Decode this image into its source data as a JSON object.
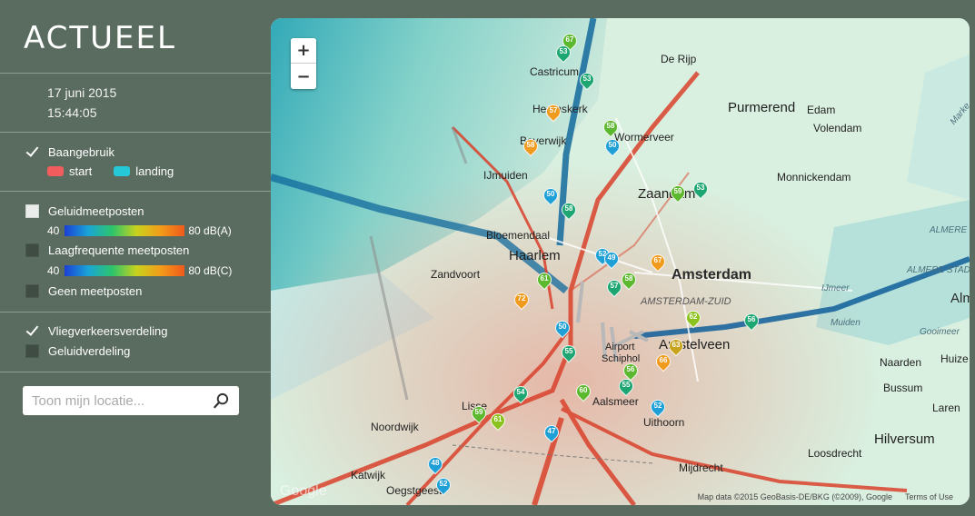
{
  "sidebar": {
    "title": "ACTUEEL",
    "date": "17 juni 2015",
    "time": "15:44:05",
    "runway_use": {
      "label": "Baangebruik",
      "checked": true,
      "legend": [
        {
          "label": "start",
          "color": "#f25c5c"
        },
        {
          "label": "landing",
          "color": "#24c8d6"
        }
      ]
    },
    "noise_posts": {
      "label": "Geluidmeetposten",
      "scale_min": "40",
      "scale_max": "80 dB(A)"
    },
    "low_freq_posts": {
      "label": "Laagfrequente meetposten",
      "scale_min": "40",
      "scale_max": "80 dB(C)"
    },
    "no_posts": {
      "label": "Geen meetposten"
    },
    "flight_distribution": {
      "label": "Vliegverkeersverdeling",
      "checked": true
    },
    "noise_distribution": {
      "label": "Geluidverdeling",
      "checked": false
    },
    "search": {
      "placeholder": "Toon mijn locatie..."
    }
  },
  "map": {
    "zoom_in": "+",
    "zoom_out": "−",
    "places": {
      "de_rijp": "De Rijp",
      "castricum": "Castricum",
      "heemskerk": "Heemskerk",
      "beverwijk": "Beverwijk",
      "wormerveer": "Wormerveer",
      "purmerend": "Purmerend",
      "edam": "Edam",
      "volendam": "Volendam",
      "ijmuiden": "IJmuiden",
      "zaandam": "Zaandam",
      "monnickendam": "Monnickendam",
      "bloemendaal": "Bloemendaal",
      "haarlem": "Haarlem",
      "zandvoort": "Zandvoort",
      "amsterdam": "Amsterdam",
      "amsterdam_zuid": "AMSTERDAM-ZUID",
      "almere": "ALMERE",
      "almere_stad": "ALMERE STAD",
      "ijmeer": "IJmeer",
      "muiden": "Muiden",
      "gooimeer": "Gooimeer",
      "amstelveen": "Amstelveen",
      "airport": "Airport",
      "schiphol": "Schiphol",
      "naarden": "Naarden",
      "huizen": "Huize",
      "bussum": "Bussum",
      "laren": "Laren",
      "hilversum": "Hilversum",
      "aalsmeer": "Aalsmeer",
      "uithoorn": "Uithoorn",
      "lisse": "Lisse",
      "noordwijk": "Noordwijk",
      "katwijk": "Katwijk",
      "oegstgeest": "Oegstgeest",
      "loosdrecht": "Loosdrecht",
      "mijdrecht": "Mijdrecht",
      "alm": "Alm",
      "amstelveen_short": "Amstelveen",
      "marken": "Marke"
    },
    "pins": [
      {
        "value": "67",
        "color": "#5cb82e"
      },
      {
        "value": "53",
        "color": "#1da672"
      },
      {
        "value": "53",
        "color": "#1da672"
      },
      {
        "value": "57",
        "color": "#f09a1e"
      },
      {
        "value": "58",
        "color": "#f09a1e"
      },
      {
        "value": "58",
        "color": "#5cb82e"
      },
      {
        "value": "50",
        "color": "#1ea0d6"
      },
      {
        "value": "50",
        "color": "#1ea0d6"
      },
      {
        "value": "59",
        "color": "#5cb82e"
      },
      {
        "value": "53",
        "color": "#1da672"
      },
      {
        "value": "58",
        "color": "#1da672"
      },
      {
        "value": "52",
        "color": "#1ea0d6"
      },
      {
        "value": "49",
        "color": "#1ea0d6"
      },
      {
        "value": "58",
        "color": "#5cb82e"
      },
      {
        "value": "67",
        "color": "#f09a1e"
      },
      {
        "value": "61",
        "color": "#5cb82e"
      },
      {
        "value": "57",
        "color": "#1da672"
      },
      {
        "value": "72",
        "color": "#f09a1e"
      },
      {
        "value": "50",
        "color": "#1ea0d6"
      },
      {
        "value": "55",
        "color": "#1da672"
      },
      {
        "value": "62",
        "color": "#8cc21e"
      },
      {
        "value": "56",
        "color": "#1da672"
      },
      {
        "value": "56",
        "color": "#5cb82e"
      },
      {
        "value": "63",
        "color": "#c8a41e"
      },
      {
        "value": "66",
        "color": "#f09a1e"
      },
      {
        "value": "55",
        "color": "#1da672"
      },
      {
        "value": "54",
        "color": "#1da672"
      },
      {
        "value": "60",
        "color": "#5cb82e"
      },
      {
        "value": "52",
        "color": "#1ea0d6"
      },
      {
        "value": "59",
        "color": "#5cb82e"
      },
      {
        "value": "61",
        "color": "#8cc21e"
      },
      {
        "value": "47",
        "color": "#1ea0d6"
      },
      {
        "value": "48",
        "color": "#1ea0d6"
      },
      {
        "value": "52",
        "color": "#1ea0d6"
      }
    ],
    "attribution": "Map data ©2015 GeoBasis-DE/BKG (©2009), Google",
    "terms": "Terms of Use",
    "logo": "Google"
  }
}
